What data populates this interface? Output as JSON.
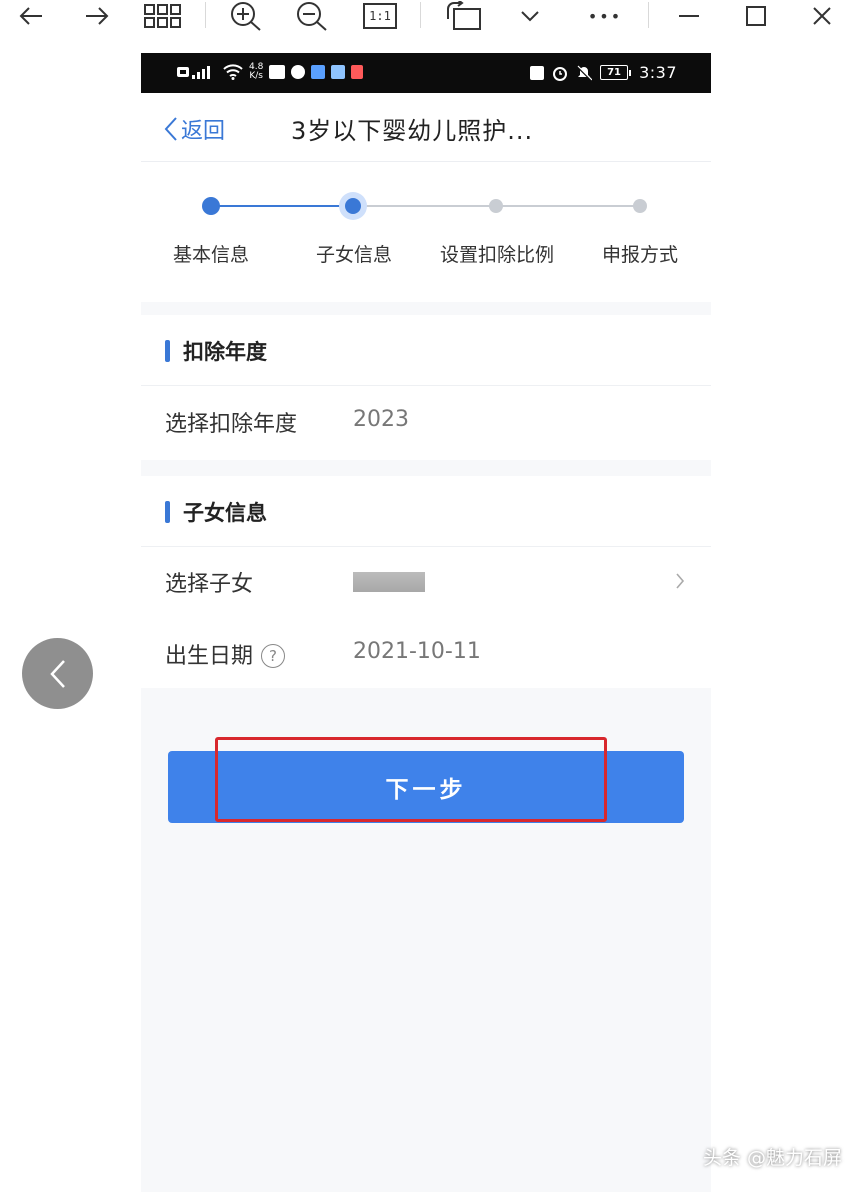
{
  "viewer": {
    "toolbar_icons": [
      "arrow-left-icon",
      "arrow-right-icon",
      "grid-icon",
      "zoom-in-icon",
      "zoom-out-icon",
      "actual-size-icon",
      "rotate-icon",
      "chevron-down-icon",
      "more-icon",
      "minimize-icon",
      "maximize-icon",
      "close-icon"
    ],
    "actual_size_label": "1:1",
    "more_label": "•••",
    "prev_page_icon": "chevron-left-icon"
  },
  "status_bar": {
    "speed_top": "4.8",
    "speed_bottom": "K/s",
    "battery": "71",
    "time": "3:37"
  },
  "nav": {
    "back_label": "返回",
    "title": "3岁以下婴幼儿照护..."
  },
  "steps": [
    {
      "label": "基本信息",
      "state": "done"
    },
    {
      "label": "子女信息",
      "state": "current"
    },
    {
      "label": "设置扣除比例",
      "state": "todo"
    },
    {
      "label": "申报方式",
      "state": "todo"
    }
  ],
  "year_section": {
    "title": "扣除年度",
    "row_label": "选择扣除年度",
    "row_value": "2023"
  },
  "child_section": {
    "title": "子女信息",
    "select_label": "选择子女",
    "birth_label": "出生日期",
    "help_glyph": "?",
    "birth_value": "2021-10-11"
  },
  "next_button": "下一步",
  "watermark": "头条 @魅力石屏",
  "colors": {
    "accent": "#3a78d6",
    "button": "#3f82ea",
    "highlight_border": "#d8282d",
    "step_inactive": "#c9cdd3"
  }
}
